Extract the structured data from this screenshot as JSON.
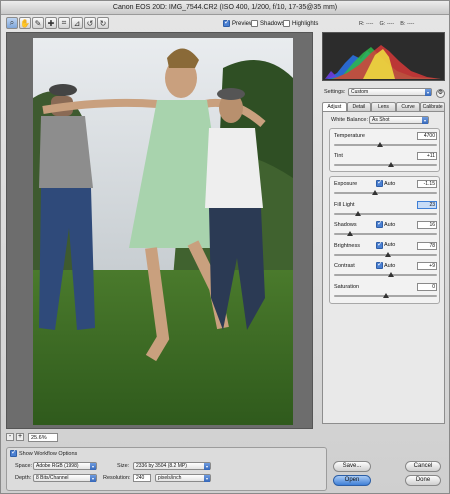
{
  "window": {
    "title": "Canon EOS 20D: IMG_7544.CR2  (ISO 400, 1/200, f/10, 17-35@35 mm)"
  },
  "toolbar": {
    "tools": [
      "zoom-icon",
      "hand-icon",
      "eyedropper-icon",
      "color-sampler-icon",
      "crop-icon",
      "straighten-icon",
      "rotate-left-icon",
      "rotate-right-icon"
    ],
    "preview": {
      "label": "Preview",
      "checked": true
    },
    "shadows": {
      "label": "Shadows",
      "checked": false
    },
    "highlights": {
      "label": "Highlights",
      "checked": false
    },
    "r_label": "R:",
    "r_value": "----",
    "g_label": "G:",
    "g_value": "----",
    "b_label": "B:",
    "b_value": "----"
  },
  "zoom": {
    "minus": "-",
    "plus": "+",
    "value": "25.6%"
  },
  "settings": {
    "label": "Settings:",
    "value": "Custom"
  },
  "tabs": [
    "Adjust",
    "Detail",
    "Lens",
    "Curve",
    "Calibrate"
  ],
  "white_balance": {
    "label": "White Balance:",
    "value": "As Shot"
  },
  "temperature": {
    "label": "Temperature",
    "value": "4700",
    "level": 0.45
  },
  "tint": {
    "label": "Tint",
    "value": "+11",
    "level": 0.55
  },
  "adjust": [
    {
      "label": "Exposure",
      "auto_label": "Auto",
      "auto": true,
      "value": "-1.15",
      "level": 0.4
    },
    {
      "label": "Fill Light",
      "auto_label": "",
      "auto": false,
      "value": "23",
      "level": 0.23,
      "highlight": true
    },
    {
      "label": "Shadows",
      "auto_label": "Auto",
      "auto": true,
      "value": "16",
      "level": 0.16
    },
    {
      "label": "Brightness",
      "auto_label": "Auto",
      "auto": true,
      "value": "78",
      "level": 0.52
    },
    {
      "label": "Contrast",
      "auto_label": "Auto",
      "auto": true,
      "value": "+9",
      "level": 0.55
    },
    {
      "label": "Saturation",
      "auto_label": "",
      "auto": false,
      "value": "0",
      "level": 0.5
    }
  ],
  "workflow": {
    "show_label": "Show Workflow Options",
    "space_label": "Space:",
    "space_value": "Adobe RGB (1998)",
    "depth_label": "Depth:",
    "depth_value": "8 Bits/Channel",
    "size_label": "Size:",
    "size_value": "2336 by 3504  (8.2 MP)",
    "resolution_label": "Resolution:",
    "resolution_value": "240",
    "resolution_unit": "pixels/inch"
  },
  "buttons": {
    "save": "Save...",
    "open": "Open",
    "cancel": "Cancel",
    "done": "Done"
  }
}
